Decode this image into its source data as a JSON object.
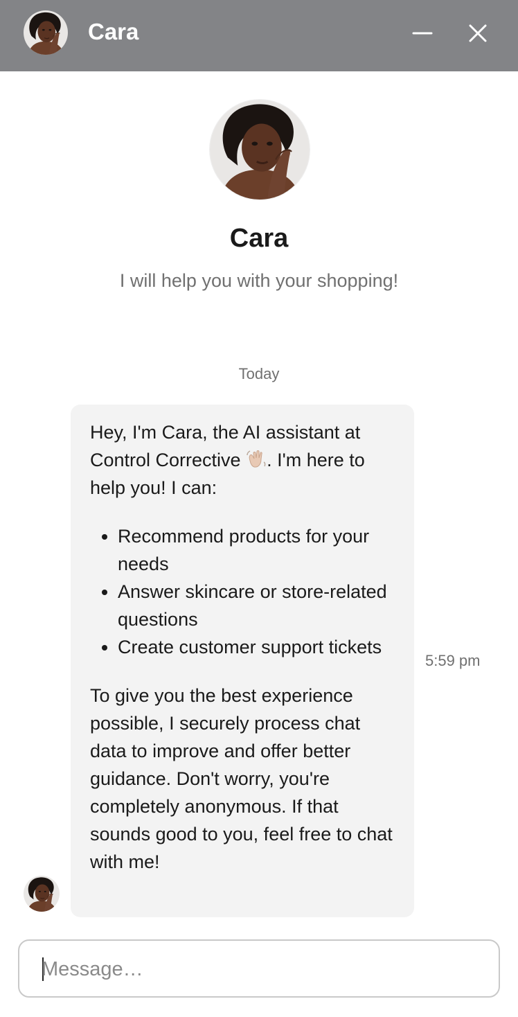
{
  "header": {
    "title": "Cara",
    "background": "#838487",
    "minimize_icon": "minimize-icon",
    "close_icon": "close-icon"
  },
  "hero": {
    "name": "Cara",
    "tagline": "I will help you with your shopping!"
  },
  "conversation": {
    "date_divider": "Today",
    "messages": [
      {
        "sender": "Cara",
        "timestamp": "5:59 pm",
        "intro_before_emoji": "Hey, I'm Cara, the AI assistant at Control Corrective ",
        "emoji": "waving-hand-emoji",
        "intro_after_emoji": ". I'm here to help you! I can:",
        "bullets": [
          "Recommend products for your needs",
          "Answer skincare or store-related questions",
          "Create customer support tickets"
        ],
        "outro": "To give you the best experience possible, I securely process chat data to improve and offer better guidance. Don't worry, you're completely anonymous. If that sounds good to you, feel free to chat with me!"
      }
    ]
  },
  "composer": {
    "placeholder": "Message…",
    "value": ""
  }
}
